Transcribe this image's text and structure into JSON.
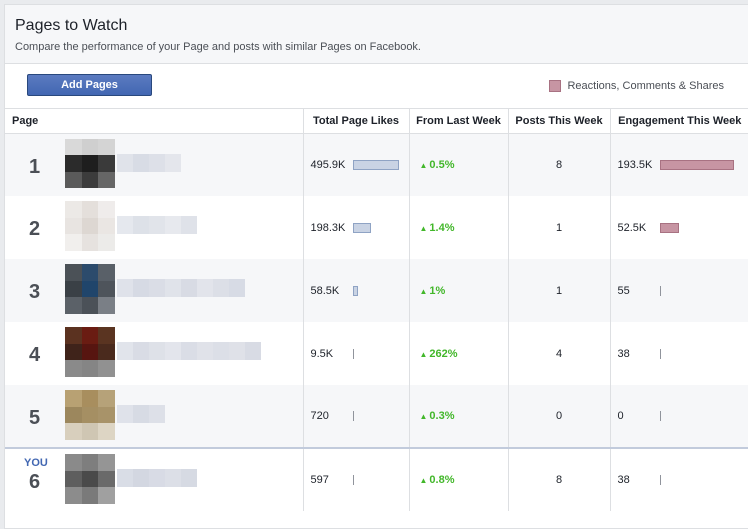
{
  "header": {
    "title": "Pages to Watch",
    "subtitle": "Compare the performance of your Page and posts with similar Pages on Facebook."
  },
  "toolbar": {
    "add_label": "Add Pages",
    "legend_label": "Reactions, Comments & Shares",
    "legend_color": "#c795a3"
  },
  "columns": [
    "Page",
    "Total Page Likes",
    "From Last Week",
    "Posts This Week",
    "Engagement This Week"
  ],
  "rows": [
    {
      "rank": "1",
      "likes": "495.9K",
      "likes_bar": 1.0,
      "change": "0.5%",
      "posts": "8",
      "engagement": "193.5K",
      "eng_bar": 1.0,
      "thumb": [
        "#d9d9d9",
        "#cfcfcf",
        "#d4d4d4",
        "#2b2b2b",
        "#1e1e1e",
        "#3a3a3a",
        "#5a5a5a",
        "#3c3c3c",
        "#666666"
      ],
      "blur": [
        "#e0e3ea",
        "#d8dce5",
        "#dde0e8",
        "#e4e6ec"
      ]
    },
    {
      "rank": "2",
      "likes": "198.3K",
      "likes_bar": 0.4,
      "change": "1.4%",
      "posts": "1",
      "engagement": "52.5K",
      "eng_bar": 0.27,
      "thumb": [
        "#ece9e6",
        "#e4dfdb",
        "#efeceb",
        "#e8e4e1",
        "#ddd7d2",
        "#eae6e3",
        "#f1efed",
        "#e6e2df",
        "#ecebe9"
      ],
      "blur": [
        "#e5e8ee",
        "#dde1e8",
        "#e1e4ea",
        "#e7e9ee",
        "#dfe2e9"
      ]
    },
    {
      "rank": "3",
      "likes": "58.5K",
      "likes_bar": 0.12,
      "change": "1%",
      "posts": "1",
      "engagement": "55",
      "eng_bar": 0,
      "thumb": [
        "#4b5157",
        "#2c4b6c",
        "#596068",
        "#3a4046",
        "#20456b",
        "#4e545b",
        "#5b6168",
        "#4b5158",
        "#7a7f86"
      ],
      "blur": [
        "#dfe2ea",
        "#d6dae4",
        "#dadde6",
        "#e0e3ea",
        "#d8dbe4",
        "#e2e4eb",
        "#dcdfe7",
        "#d7dbe5"
      ]
    },
    {
      "rank": "4",
      "likes": "9.5K",
      "likes_bar": 0,
      "change": "262%",
      "posts": "4",
      "engagement": "38",
      "eng_bar": 0,
      "thumb": [
        "#5b3220",
        "#6a1c12",
        "#5a3421",
        "#3f231a",
        "#571510",
        "#4a2a1d",
        "#8a8a8a",
        "#858585",
        "#919191"
      ],
      "blur": [
        "#e1e4eb",
        "#d9dce5",
        "#dee1e8",
        "#e3e5ec",
        "#dadde6",
        "#e0e2e9",
        "#dcdfe7",
        "#dfe1e8",
        "#d8dbe4"
      ]
    },
    {
      "rank": "5",
      "likes": "720",
      "likes_bar": 0,
      "change": "0.3%",
      "posts": "0",
      "engagement": "0",
      "eng_bar": 0,
      "thumb": [
        "#b8a173",
        "#a88e5e",
        "#b6a279",
        "#9c875d",
        "#a58f63",
        "#a89369",
        "#d8cfbd",
        "#cfc6b3",
        "#ddd5c4"
      ],
      "blur": [
        "#dfe2ea",
        "#d7dbe4",
        "#dde0e8"
      ]
    },
    {
      "rank": "6",
      "you": "YOU",
      "likes": "597",
      "likes_bar": 0,
      "change": "0.8%",
      "posts": "8",
      "engagement": "38",
      "eng_bar": 0,
      "thumb": [
        "#8a8a8a",
        "#7e7e7e",
        "#959595",
        "#5e5e5e",
        "#4a4a4a",
        "#6a6a6a",
        "#8c8c8c",
        "#7a7a7a",
        "#a0a0a0"
      ],
      "blur": [
        "#d9dde6",
        "#d3d7e1",
        "#d8dbe5",
        "#dcdfe7",
        "#d6dae3"
      ]
    }
  ]
}
